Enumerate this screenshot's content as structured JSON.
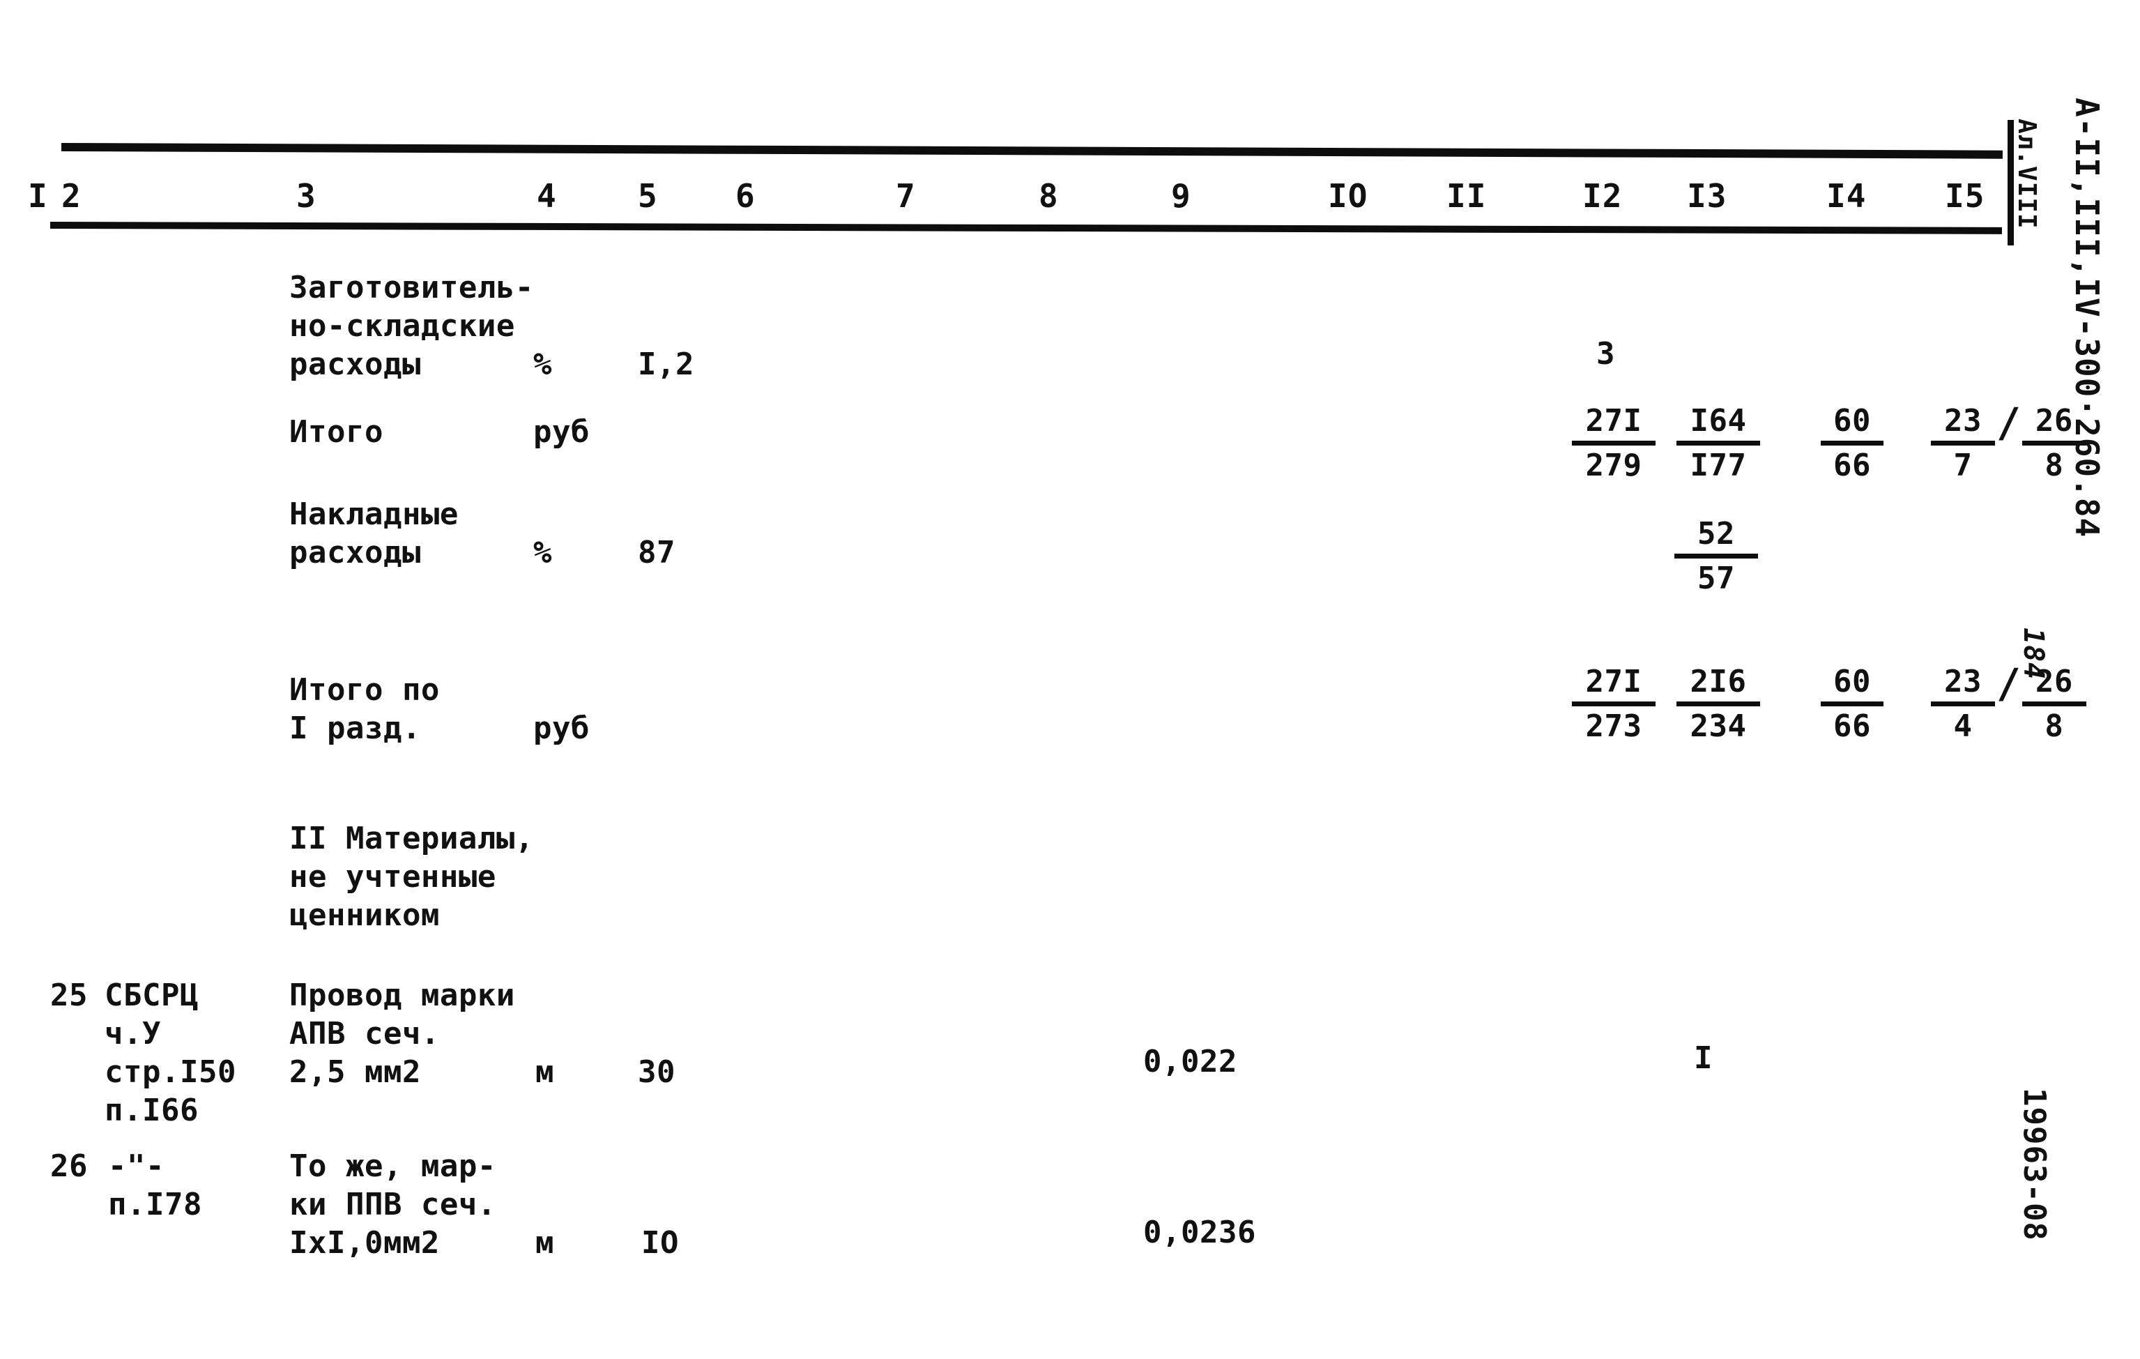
{
  "document": {
    "sheet_code": "А-II,III,IV-300·260.84",
    "album": "Ал.VIII",
    "page_number": "184",
    "order_code": "19963-08"
  },
  "table": {
    "column_headers": [
      "I",
      "2",
      "3",
      "4",
      "5",
      "6",
      "7",
      "8",
      "9",
      "IO",
      "II",
      "I2",
      "I3",
      "I4",
      "I5"
    ],
    "rows": [
      {
        "id": "zagotovitelno-skladskie",
        "num": "",
        "ref": "",
        "name_lines": [
          "Заготовитель-",
          "но-складские",
          "расходы"
        ],
        "unit": "%",
        "qty": "I,2",
        "col9": "",
        "col12": "3",
        "col13": "",
        "col14": "",
        "col15": ""
      },
      {
        "id": "itogo",
        "num": "",
        "ref": "",
        "name_lines": [
          "Итого"
        ],
        "unit": "руб",
        "qty": "",
        "col9": "",
        "col12": {
          "num": "27I",
          "den": "279"
        },
        "col13": {
          "num": "I64",
          "den": "I77"
        },
        "col14": {
          "num": "60",
          "den": "66"
        },
        "col15": {
          "left": {
            "num": "23",
            "den": "7"
          },
          "right": {
            "num": "26",
            "den": "8"
          }
        }
      },
      {
        "id": "nakladnye-rashody",
        "num": "",
        "ref": "",
        "name_lines": [
          "Накладные",
          "расходы"
        ],
        "unit": "%",
        "qty": "87",
        "col9": "",
        "col12": "",
        "col13": {
          "num": "52",
          "den": "57"
        },
        "col14": "",
        "col15": ""
      },
      {
        "id": "itogo-po-razd-1",
        "num": "",
        "ref": "",
        "name_lines": [
          "Итого по",
          "I разд."
        ],
        "unit": "руб",
        "qty": "",
        "col9": "",
        "col12": {
          "num": "27I",
          "den": "273"
        },
        "col13": {
          "num": "2I6",
          "den": "234"
        },
        "col14": {
          "num": "60",
          "den": "66"
        },
        "col15": {
          "left": {
            "num": "23",
            "den": "4"
          },
          "right": {
            "num": "26",
            "den": "8"
          }
        }
      },
      {
        "id": "section-2-heading",
        "num": "",
        "ref": "",
        "name_lines": [
          "II Материалы,",
          "не учтенные",
          "ценником"
        ],
        "unit": "",
        "qty": "",
        "col9": "",
        "col12": "",
        "col13": "",
        "col14": "",
        "col15": ""
      },
      {
        "id": "row-25",
        "num": "25",
        "ref_lines": [
          "СБСРЦ",
          "ч.У",
          "стр.I50",
          "п.I66"
        ],
        "name_lines": [
          "Провод марки",
          "АПВ сеч.",
          "2,5 мм2"
        ],
        "unit": "м",
        "qty": "30",
        "col9": "0,022",
        "col12": "",
        "col13": "I",
        "col14": "",
        "col15": ""
      },
      {
        "id": "row-26",
        "num": "26",
        "ref_lines": [
          "-\"-",
          "п.I78"
        ],
        "name_lines": [
          "То же, мар-",
          "ки ППВ сеч.",
          "IxI,0мм2"
        ],
        "unit": "м",
        "qty": "IO",
        "col9": "0,0236",
        "col12": "",
        "col13": "",
        "col14": "",
        "col15": ""
      }
    ]
  }
}
